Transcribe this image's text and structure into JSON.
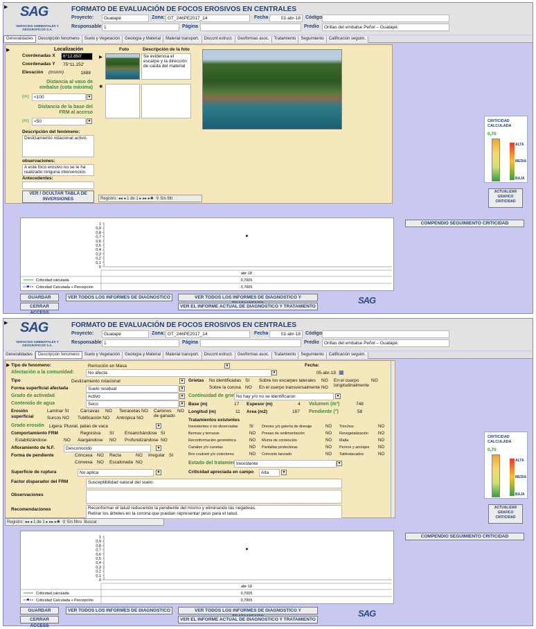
{
  "form": {
    "title": "FORMATO DE EVALUACIÓN DE FOCOS EROSIVOS EN CENTRALES",
    "logo": "SAG",
    "logo_sub": "SERVICIOS AMBIENTALES Y GEOGRÁFICOS S.A.",
    "proyecto_label": "Proyecto:",
    "proyecto": "Guatapé",
    "zona_label": "Zona:",
    "zona": "GT_246PE2017_14",
    "fecha_label": "Fecha",
    "fecha": "01-abr-18",
    "codigo_label": "Código",
    "codigo": "",
    "responsable_label": "Responsable:",
    "responsable": "1",
    "pagina_label": "Página",
    "pagina": "",
    "predio_label": "Predio",
    "predio": "Orillas del embalse Peñol – Guatapé."
  },
  "tabs": [
    "Generalidades",
    "Descripción fenomeno",
    "Suelo y Vegetación",
    "Geología y Material",
    "Material transport.",
    "Discont estruct.",
    "Geoformas asoc.",
    "Tratamiento",
    "Seguimiento",
    "Calificación seguim."
  ],
  "tabs2": [
    "Generalidades",
    "Descripción fenomeno",
    "Suelo y Vegetación",
    "Geología y Material",
    "Material transport.",
    "Discont estruct.",
    "Geoformas asoc.",
    "Tratamiento",
    "Seguimiento",
    "Calificación seguim."
  ],
  "gen": {
    "loc_label": "Localización",
    "cx_label": "Coordenadas X",
    "cx": "6°12.850'",
    "cy_label": "Coordenadas Y",
    "cy": "75°11.152'",
    "elev_label": "Elevación",
    "elev_unit": "(msnm)",
    "elev": "1888",
    "dist_vaso_label": "Distancia al vaso de embalse (cota máxima)",
    "dist_unit": "(m)",
    "dist_vaso": "<100",
    "dist_base_label": "Distancia de la base del FRM al acceso",
    "dist_base": "<50",
    "desc_label": "Descripción del fenómeno:",
    "desc": "Deslizamiento rotacional activo.",
    "obs_label": "observaciones:",
    "obs": "A este foco erosivo no se le ha realizado ninguna intervención.",
    "ant_label": "Antecedentes:",
    "ver_btn": "VER / OCULTAR TABLA DE INVERSIONES",
    "foto_label": "Foto",
    "desc_foto_label": "Descripción de la foto",
    "desc_foto": "Se evidencia el escarpe y la dirección de caída del material",
    "nav_reg": "Registro:",
    "nav_pos": "1 de 1",
    "nav_filter": "Sin filtr"
  },
  "crit": {
    "title": "CRITICIDAD CALCULADA",
    "value": "0,70",
    "alta": "ALTA",
    "media": "MEDIA",
    "baja": "BAJA",
    "btn": "ACTUALIZAR GRAFICO CRITICIDAD"
  },
  "chart1": {
    "ticks": [
      "1",
      "0,9",
      "0,8",
      "0,7",
      "0,6",
      "0,5",
      "0,4",
      "0,3",
      "0,2",
      "0,1",
      "0"
    ],
    "xlabel": "abr-18",
    "s1": "Criticidad calculada",
    "s1v": "0,7005",
    "s2": "Criticidad Calculada + Percepción",
    "s2v": "0,7005"
  },
  "compendio": "COMPENDIO SEGUIMIENTO CRITICIDAD",
  "bottom": {
    "guardar": "GUARDAR",
    "cerrar": "CERRAR ACCESS",
    "diag": "VER TODOS LOS INFORMES DE DIAGNOSTICO",
    "diagtrat": "VER TODOS LOS INFORMES DE DIAGNOSTICO Y TRATAMIENTO",
    "actual": "VER EL INFORME ACTUAL DE DIAGNOSTICO Y TRATAMIENTO"
  },
  "desc": {
    "tipo_fen_label": "Tipo de fenomeno:",
    "tipo_fen": "Remoción en Masa",
    "fecha_label": "Fecha:",
    "fecha": "05-abr-18",
    "afect_label": "Afectación a la comunidad:",
    "afect": "No afecta",
    "tipo_label": "Tipo",
    "tipo": "Deslizamiento rotacional",
    "forma_sup_label": "Forma superficial afectada",
    "forma_sup": "Suelo residual",
    "grado_act_label": "Grado de actividad",
    "grado_act": "Activo",
    "contenido_label": "Contenido de agua",
    "contenido": "Seco",
    "erosion_label": "Erosión superficial",
    "laminar": "Laminar SI",
    "carcavas": "Cárcavas",
    "terracetas": "Terracetas NO",
    "caminos": "Caminos de ganado",
    "surcos": "Surcos NO",
    "tubific": "Tubificación NO",
    "antropica": "Antrópica NO",
    "no": "NO",
    "grado_eros_label": "Grado erosión",
    "grado_eros": "Ligera: Pluvial, patas de vaca",
    "comp_label": "Comportamiento FRM",
    "regresiva": "Regresiva",
    "si": "SI",
    "ensanch": "Ensanchándose",
    "estabil": "Estabilizándose",
    "alarg": "Alargándose",
    "profund": "Profundizándose",
    "aflor_label": "Afloramiento de N.F.",
    "aflor": "Desconocido",
    "pend_label": "Forma de pendiente",
    "concava": "Cóncava",
    "recta": "Recta",
    "irregular": "Irregular",
    "convexa": "Convexa",
    "escalonada": "Escalonada",
    "sup_rup_label": "Superficie de ruptura",
    "sup_rup": "No aplica",
    "grietas_label": "Grietas",
    "no_ident": "No identificadas",
    "sobre_escarpes": "Sobre los escarpes laterales",
    "en_cuerpo_long": "En el cuerpo longitudinalmente",
    "sobre_corona": "Sobre la corona",
    "en_cuerpo_trans": "En el cuerpo transversalmente",
    "cont_grietas_label": "Continuidad de grietas",
    "cont_grietas": "No hay y/o no se identificaron",
    "base_label": "Base (m)",
    "base": "17",
    "espesor_label": "Espesor (m)",
    "espesor": "4",
    "volumen_label": "Volumen (m³)",
    "volumen": "748",
    "longitud_label": "Longitud (m)",
    "longitud": "11",
    "area_label": "Area (m2)",
    "area": "187",
    "pendiente_label": "Pendiente (°)",
    "pendiente": "58",
    "trat_label": "Tratamientos existentes",
    "trat": [
      [
        "Inexistentes o no observadas",
        "SI",
        "Drenes y/o galería de drenaje",
        "NO",
        "Trinchos",
        "NO"
      ],
      [
        "Bermas y terrazas",
        "NO",
        "Presas de sedimentación",
        "NO",
        "Revegetalización",
        "NO"
      ],
      [
        "Reconformación geométrica",
        "NO",
        "Muros de contención",
        "NO",
        "Malla",
        "NO"
      ],
      [
        "Canales y/o cunetas",
        "NO",
        "Pantallas protectoras",
        "NO",
        "Pernos y anclajes",
        "NO"
      ],
      [
        "Box coulvert y/o colectores",
        "NO",
        "Concreto lanzado",
        "NO",
        "Tablestacados",
        "NO"
      ]
    ],
    "estado_label": "Estado del tratamiento:",
    "estado": "Inexistente",
    "crit_campo_label": "Criticidad apreciada en campo",
    "crit_campo": "Alta",
    "factor_label": "Factor disparador del FRM",
    "factor": "Susceptibilidad natural del suelo.",
    "obs_label": "Observaciones",
    "obs": "",
    "rec_label": "Recomendaciones",
    "rec1": "Reconformar el talud reduciendo la pendiente del mismo y eliminando las negativas.",
    "rec2": "Retirar los árboles en la corona que puedan representar peso para el talud.",
    "nav_reg": "Registro:",
    "nav_pos": "1 de 1",
    "nav_filter": "Sin filtro",
    "buscar": "Buscar"
  }
}
